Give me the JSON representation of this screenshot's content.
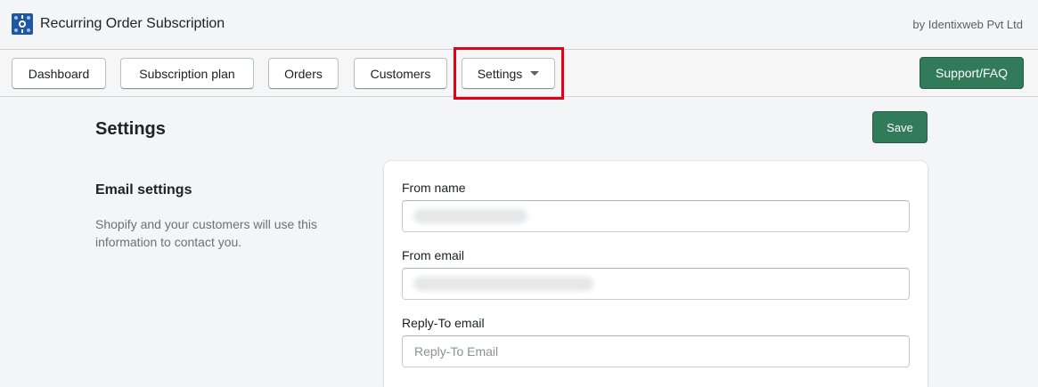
{
  "app": {
    "title": "Recurring Order Subscription",
    "byline": "by Identixweb Pvt Ltd",
    "logo_icon": "app-logo-icon",
    "logo_color": "#1f57a3"
  },
  "nav": {
    "dashboard": "Dashboard",
    "subscription_plan": "Subscription plan",
    "orders": "Orders",
    "customers": "Customers",
    "settings": "Settings",
    "support": "Support/FAQ",
    "highlight_color": "#e3001b"
  },
  "page": {
    "title": "Settings",
    "save_label": "Save",
    "primary_color": "#317a5a"
  },
  "email_settings": {
    "heading": "Email settings",
    "description": "Shopify and your customers will use this information to contact you.",
    "from_name": {
      "label": "From name",
      "value": ""
    },
    "from_email": {
      "label": "From email",
      "value": ""
    },
    "reply_to": {
      "label": "Reply-To email",
      "value": "",
      "placeholder": "Reply-To Email"
    }
  }
}
